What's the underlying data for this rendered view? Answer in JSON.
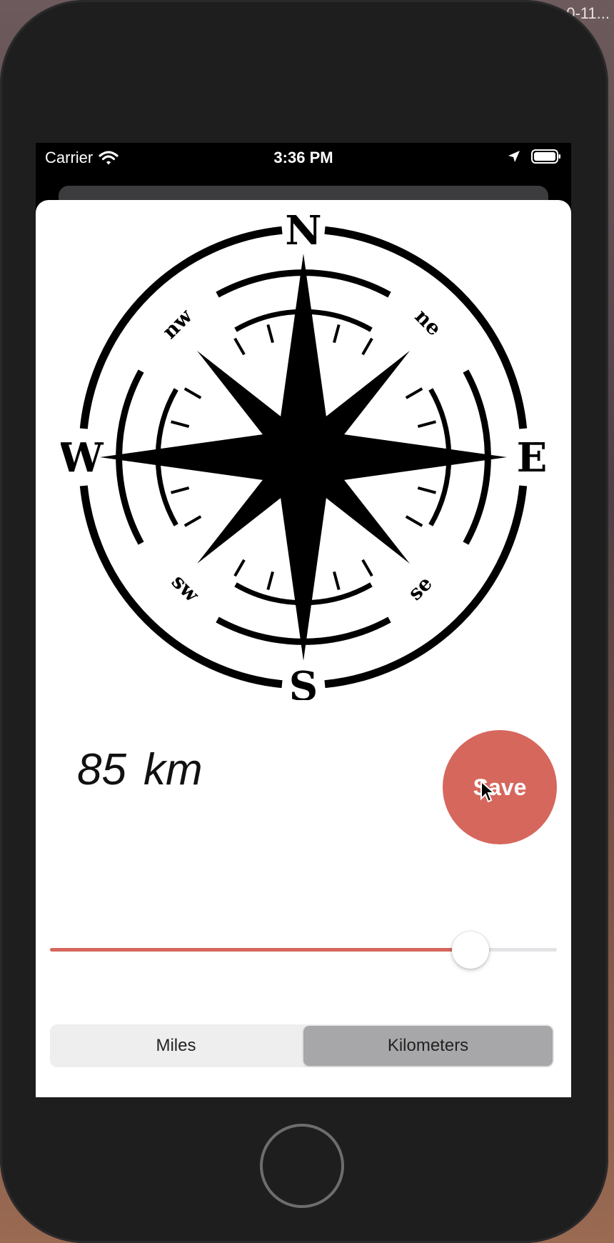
{
  "window_label": "0-11...",
  "status_bar": {
    "carrier": "Carrier",
    "time": "3:36 PM",
    "icons": [
      "wifi-icon",
      "location-arrow-icon",
      "battery-icon"
    ]
  },
  "compass": {
    "cardinals": {
      "n": "N",
      "e": "E",
      "s": "S",
      "w": "W"
    },
    "intercardinals": {
      "ne": "ne",
      "se": "se",
      "sw": "sw",
      "nw": "nw"
    }
  },
  "distance": {
    "value": "85",
    "unit": "km"
  },
  "save_button": {
    "label": "Save"
  },
  "slider": {
    "value_fraction": 0.83,
    "accent": "#d6675d"
  },
  "unit_toggle": {
    "options": [
      "Miles",
      "Kilometers"
    ],
    "selected": "Kilometers"
  },
  "colors": {
    "accent": "#d6675d",
    "device": "#1e1e1e"
  }
}
